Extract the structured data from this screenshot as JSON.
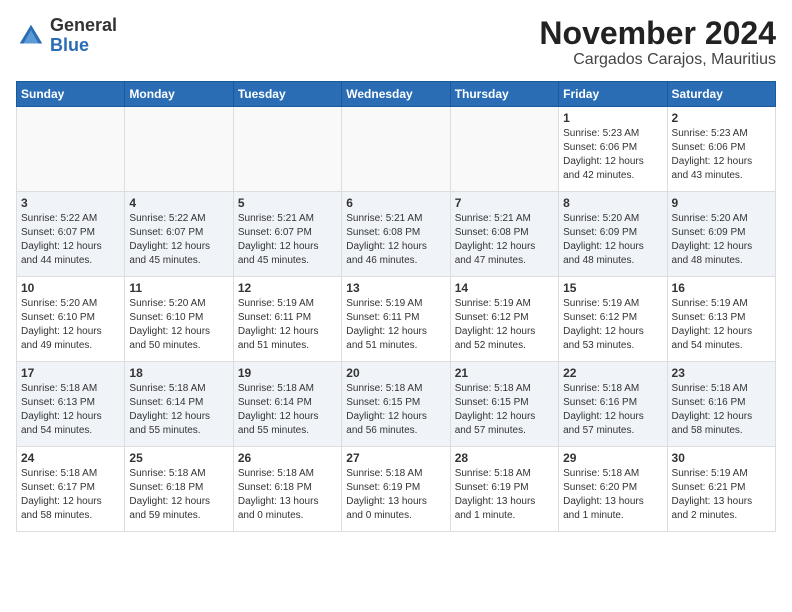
{
  "logo": {
    "general": "General",
    "blue": "Blue"
  },
  "title": "November 2024",
  "subtitle": "Cargados Carajos, Mauritius",
  "days_of_week": [
    "Sunday",
    "Monday",
    "Tuesday",
    "Wednesday",
    "Thursday",
    "Friday",
    "Saturday"
  ],
  "weeks": [
    [
      {
        "day": "",
        "info": ""
      },
      {
        "day": "",
        "info": ""
      },
      {
        "day": "",
        "info": ""
      },
      {
        "day": "",
        "info": ""
      },
      {
        "day": "",
        "info": ""
      },
      {
        "day": "1",
        "info": "Sunrise: 5:23 AM\nSunset: 6:06 PM\nDaylight: 12 hours\nand 42 minutes."
      },
      {
        "day": "2",
        "info": "Sunrise: 5:23 AM\nSunset: 6:06 PM\nDaylight: 12 hours\nand 43 minutes."
      }
    ],
    [
      {
        "day": "3",
        "info": "Sunrise: 5:22 AM\nSunset: 6:07 PM\nDaylight: 12 hours\nand 44 minutes."
      },
      {
        "day": "4",
        "info": "Sunrise: 5:22 AM\nSunset: 6:07 PM\nDaylight: 12 hours\nand 45 minutes."
      },
      {
        "day": "5",
        "info": "Sunrise: 5:21 AM\nSunset: 6:07 PM\nDaylight: 12 hours\nand 45 minutes."
      },
      {
        "day": "6",
        "info": "Sunrise: 5:21 AM\nSunset: 6:08 PM\nDaylight: 12 hours\nand 46 minutes."
      },
      {
        "day": "7",
        "info": "Sunrise: 5:21 AM\nSunset: 6:08 PM\nDaylight: 12 hours\nand 47 minutes."
      },
      {
        "day": "8",
        "info": "Sunrise: 5:20 AM\nSunset: 6:09 PM\nDaylight: 12 hours\nand 48 minutes."
      },
      {
        "day": "9",
        "info": "Sunrise: 5:20 AM\nSunset: 6:09 PM\nDaylight: 12 hours\nand 48 minutes."
      }
    ],
    [
      {
        "day": "10",
        "info": "Sunrise: 5:20 AM\nSunset: 6:10 PM\nDaylight: 12 hours\nand 49 minutes."
      },
      {
        "day": "11",
        "info": "Sunrise: 5:20 AM\nSunset: 6:10 PM\nDaylight: 12 hours\nand 50 minutes."
      },
      {
        "day": "12",
        "info": "Sunrise: 5:19 AM\nSunset: 6:11 PM\nDaylight: 12 hours\nand 51 minutes."
      },
      {
        "day": "13",
        "info": "Sunrise: 5:19 AM\nSunset: 6:11 PM\nDaylight: 12 hours\nand 51 minutes."
      },
      {
        "day": "14",
        "info": "Sunrise: 5:19 AM\nSunset: 6:12 PM\nDaylight: 12 hours\nand 52 minutes."
      },
      {
        "day": "15",
        "info": "Sunrise: 5:19 AM\nSunset: 6:12 PM\nDaylight: 12 hours\nand 53 minutes."
      },
      {
        "day": "16",
        "info": "Sunrise: 5:19 AM\nSunset: 6:13 PM\nDaylight: 12 hours\nand 54 minutes."
      }
    ],
    [
      {
        "day": "17",
        "info": "Sunrise: 5:18 AM\nSunset: 6:13 PM\nDaylight: 12 hours\nand 54 minutes."
      },
      {
        "day": "18",
        "info": "Sunrise: 5:18 AM\nSunset: 6:14 PM\nDaylight: 12 hours\nand 55 minutes."
      },
      {
        "day": "19",
        "info": "Sunrise: 5:18 AM\nSunset: 6:14 PM\nDaylight: 12 hours\nand 55 minutes."
      },
      {
        "day": "20",
        "info": "Sunrise: 5:18 AM\nSunset: 6:15 PM\nDaylight: 12 hours\nand 56 minutes."
      },
      {
        "day": "21",
        "info": "Sunrise: 5:18 AM\nSunset: 6:15 PM\nDaylight: 12 hours\nand 57 minutes."
      },
      {
        "day": "22",
        "info": "Sunrise: 5:18 AM\nSunset: 6:16 PM\nDaylight: 12 hours\nand 57 minutes."
      },
      {
        "day": "23",
        "info": "Sunrise: 5:18 AM\nSunset: 6:16 PM\nDaylight: 12 hours\nand 58 minutes."
      }
    ],
    [
      {
        "day": "24",
        "info": "Sunrise: 5:18 AM\nSunset: 6:17 PM\nDaylight: 12 hours\nand 58 minutes."
      },
      {
        "day": "25",
        "info": "Sunrise: 5:18 AM\nSunset: 6:18 PM\nDaylight: 12 hours\nand 59 minutes."
      },
      {
        "day": "26",
        "info": "Sunrise: 5:18 AM\nSunset: 6:18 PM\nDaylight: 13 hours\nand 0 minutes."
      },
      {
        "day": "27",
        "info": "Sunrise: 5:18 AM\nSunset: 6:19 PM\nDaylight: 13 hours\nand 0 minutes."
      },
      {
        "day": "28",
        "info": "Sunrise: 5:18 AM\nSunset: 6:19 PM\nDaylight: 13 hours\nand 1 minute."
      },
      {
        "day": "29",
        "info": "Sunrise: 5:18 AM\nSunset: 6:20 PM\nDaylight: 13 hours\nand 1 minute."
      },
      {
        "day": "30",
        "info": "Sunrise: 5:19 AM\nSunset: 6:21 PM\nDaylight: 13 hours\nand 2 minutes."
      }
    ]
  ]
}
